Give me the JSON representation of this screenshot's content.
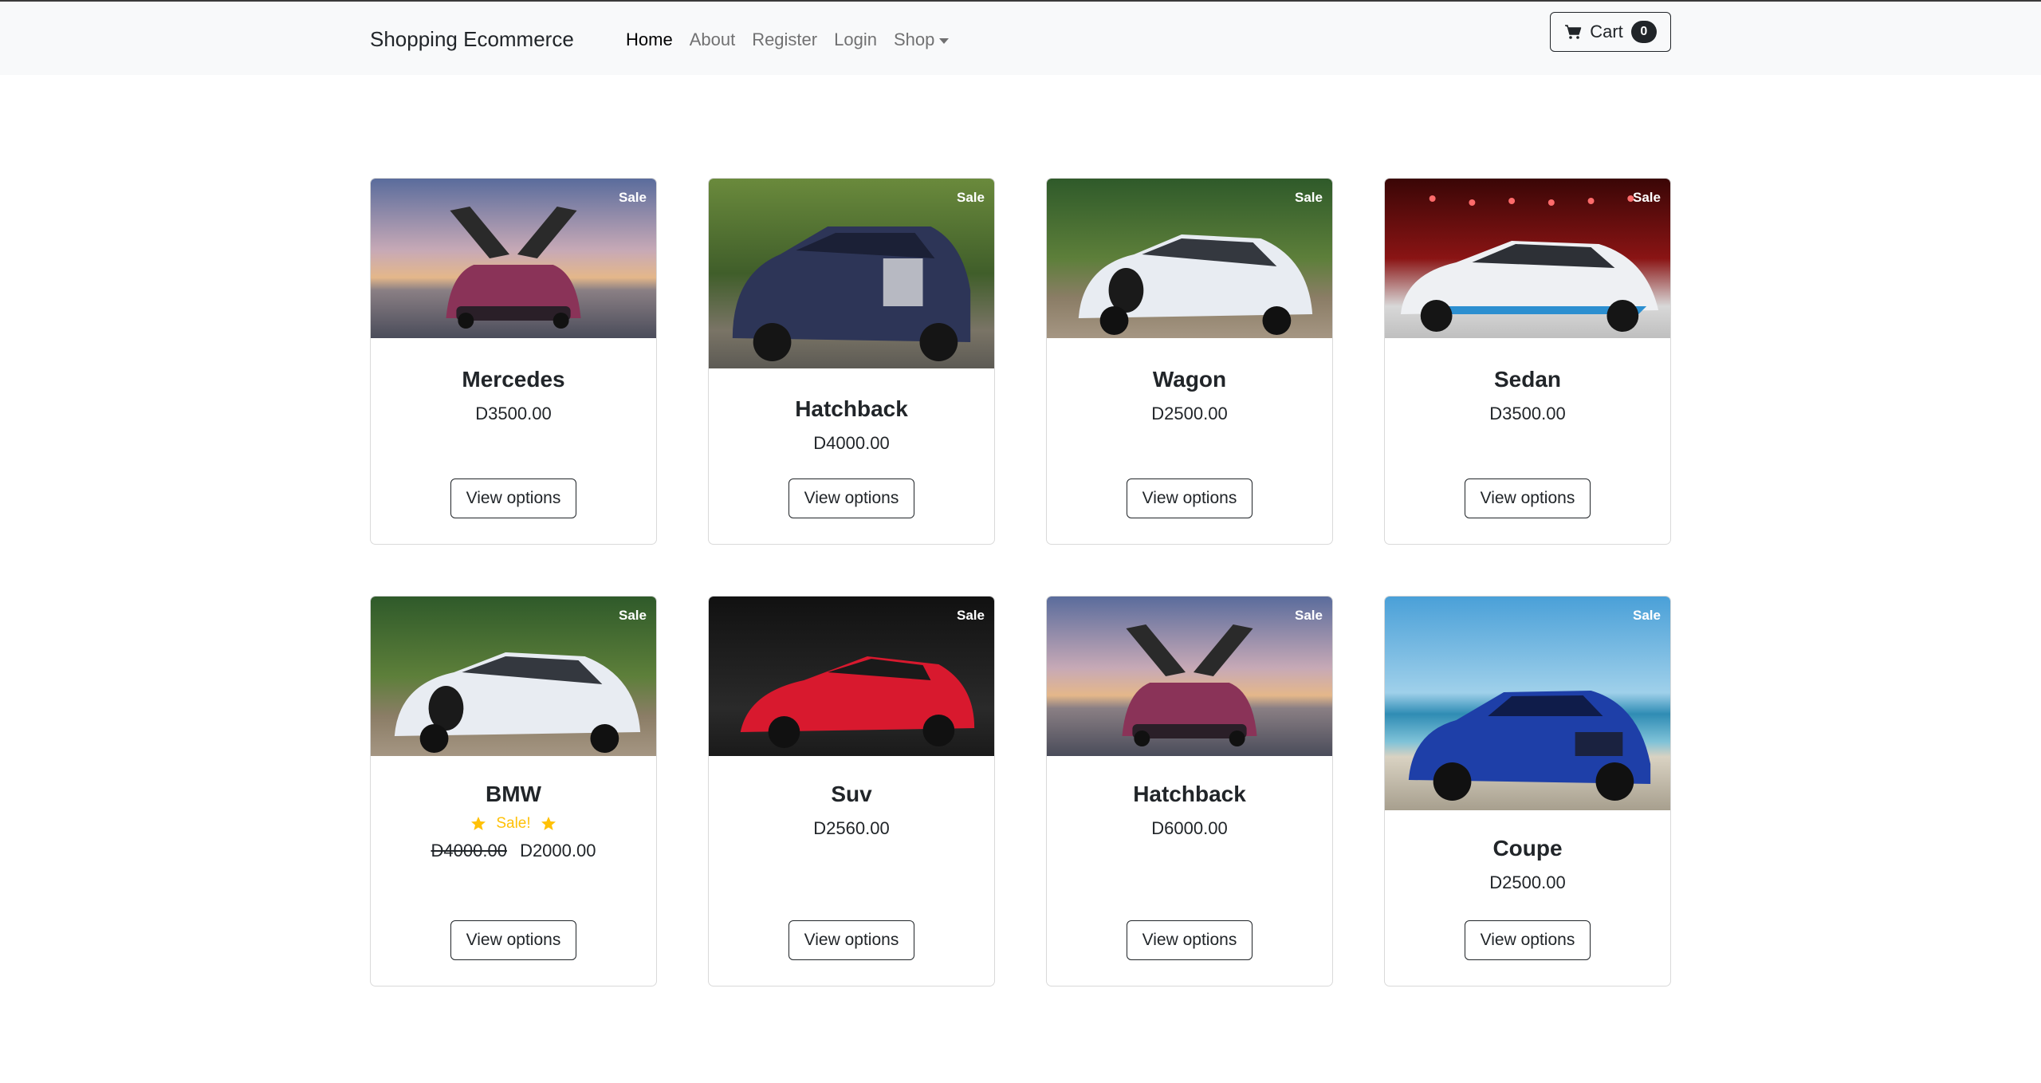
{
  "navbar": {
    "brand": "Shopping Ecommerce",
    "links": [
      "Home",
      "About",
      "Register",
      "Login"
    ],
    "shop_label": "Shop",
    "cart_label": "Cart",
    "cart_count": "0"
  },
  "products": [
    {
      "name": "Mercedes",
      "price": "D3500.00",
      "badge": "Sale",
      "button": "View options",
      "image": "silver-gullwing-car"
    },
    {
      "name": "Hatchback",
      "price": "D4000.00",
      "badge": "Sale",
      "button": "View options",
      "image": "navy-luxury-sedan"
    },
    {
      "name": "Wagon",
      "price": "D2500.00",
      "badge": "Sale",
      "button": "View options",
      "image": "white-hypercar-forest"
    },
    {
      "name": "Sedan",
      "price": "D3500.00",
      "badge": "Sale",
      "button": "View options",
      "image": "white-hypercar-stage"
    },
    {
      "name": "BMW",
      "old_price": "D4000.00",
      "price": "D2000.00",
      "sale_text": "Sale!",
      "badge": "Sale",
      "button": "View options",
      "image": "white-hypercar-road"
    },
    {
      "name": "Suv",
      "price": "D2560.00",
      "badge": "Sale",
      "button": "View options",
      "image": "red-sports-car"
    },
    {
      "name": "Hatchback",
      "price": "D6000.00",
      "badge": "Sale",
      "button": "View options",
      "image": "silver-gullwing-car"
    },
    {
      "name": "Coupe",
      "price": "D2500.00",
      "badge": "Sale",
      "button": "View options",
      "image": "blue-sedan-beach"
    }
  ],
  "colors": {
    "navbar_bg": "#f8f9fa",
    "text": "#212529",
    "star": "#ffc107"
  }
}
